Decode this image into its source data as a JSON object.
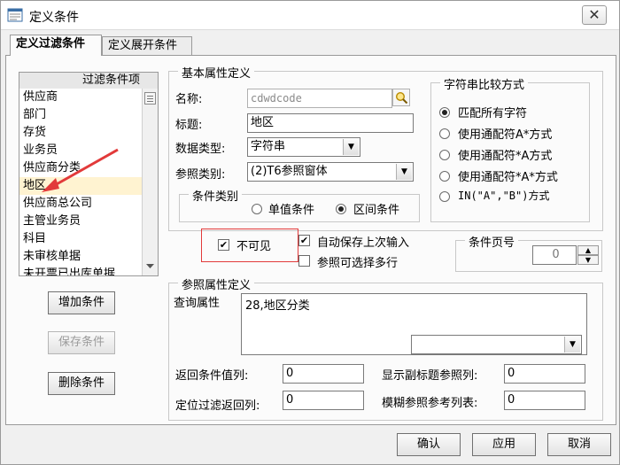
{
  "window": {
    "title": "定义条件",
    "close_symbol": "✕"
  },
  "tabs": [
    {
      "label": "定义过滤条件",
      "active": true
    },
    {
      "label": "定义展开条件",
      "active": false
    }
  ],
  "filter_list": {
    "header": "过滤条件项",
    "items": [
      "供应商",
      "部门",
      "存货",
      "业务员",
      "供应商分类",
      "地区",
      "供应商总公司",
      "主管业务员",
      "科目",
      "未审核单据",
      "未开票已出库单据"
    ],
    "selected": "地区"
  },
  "left_buttons": {
    "add": "增加条件",
    "save": "保存条件",
    "delete": "删除条件"
  },
  "basic_props": {
    "group_title": "基本属性定义",
    "name_label": "名称:",
    "name_value": "cdwdcode",
    "title_label": "标题:",
    "title_value": "地区",
    "datatype_label": "数据类型:",
    "datatype_value": "字符串",
    "reftype_label": "参照类别:",
    "reftype_value": "(2)T6参照窗体",
    "condition_type": {
      "group_title": "条件类别",
      "single": "单值条件",
      "range": "区间条件",
      "selected": "range"
    }
  },
  "string_compare": {
    "group_title": "字符串比较方式",
    "options": [
      "匹配所有字符",
      "使用通配符A*方式",
      "使用通配符*A方式",
      "使用通配符*A*方式",
      "IN(\"A\",\"B\")方式"
    ],
    "selected": 0
  },
  "checkboxes": {
    "invisible": {
      "label": "不可见",
      "checked": true
    },
    "autosave": {
      "label": "自动保存上次输入",
      "checked": true
    },
    "multiselect": {
      "label": "参照可选择多行",
      "checked": false
    }
  },
  "page": {
    "group_title": "条件页号",
    "value": "0",
    "up": "▲",
    "down": "▼"
  },
  "ref_props": {
    "group_title": "参照属性定义",
    "query_label": "查询属性",
    "query_value": "28,地区分类",
    "dropdown_value": "",
    "return_col_label": "返回条件值列:",
    "return_col_value": "0",
    "subtitle_col_label": "显示副标题参照列:",
    "subtitle_col_value": "0",
    "locate_col_label": "定位过滤返回列:",
    "locate_col_value": "0",
    "fuzzy_col_label": "模糊参照参考列表:",
    "fuzzy_col_value": "0"
  },
  "bottom_buttons": {
    "ok": "确认",
    "apply": "应用",
    "cancel": "取消"
  },
  "colors": {
    "selection": "#fff3d1",
    "annotation_red": "#e23a3a"
  },
  "icons": {
    "app": "form-icon",
    "lookup": "magnifier-icon",
    "dropdown": "chevron-down-icon"
  }
}
